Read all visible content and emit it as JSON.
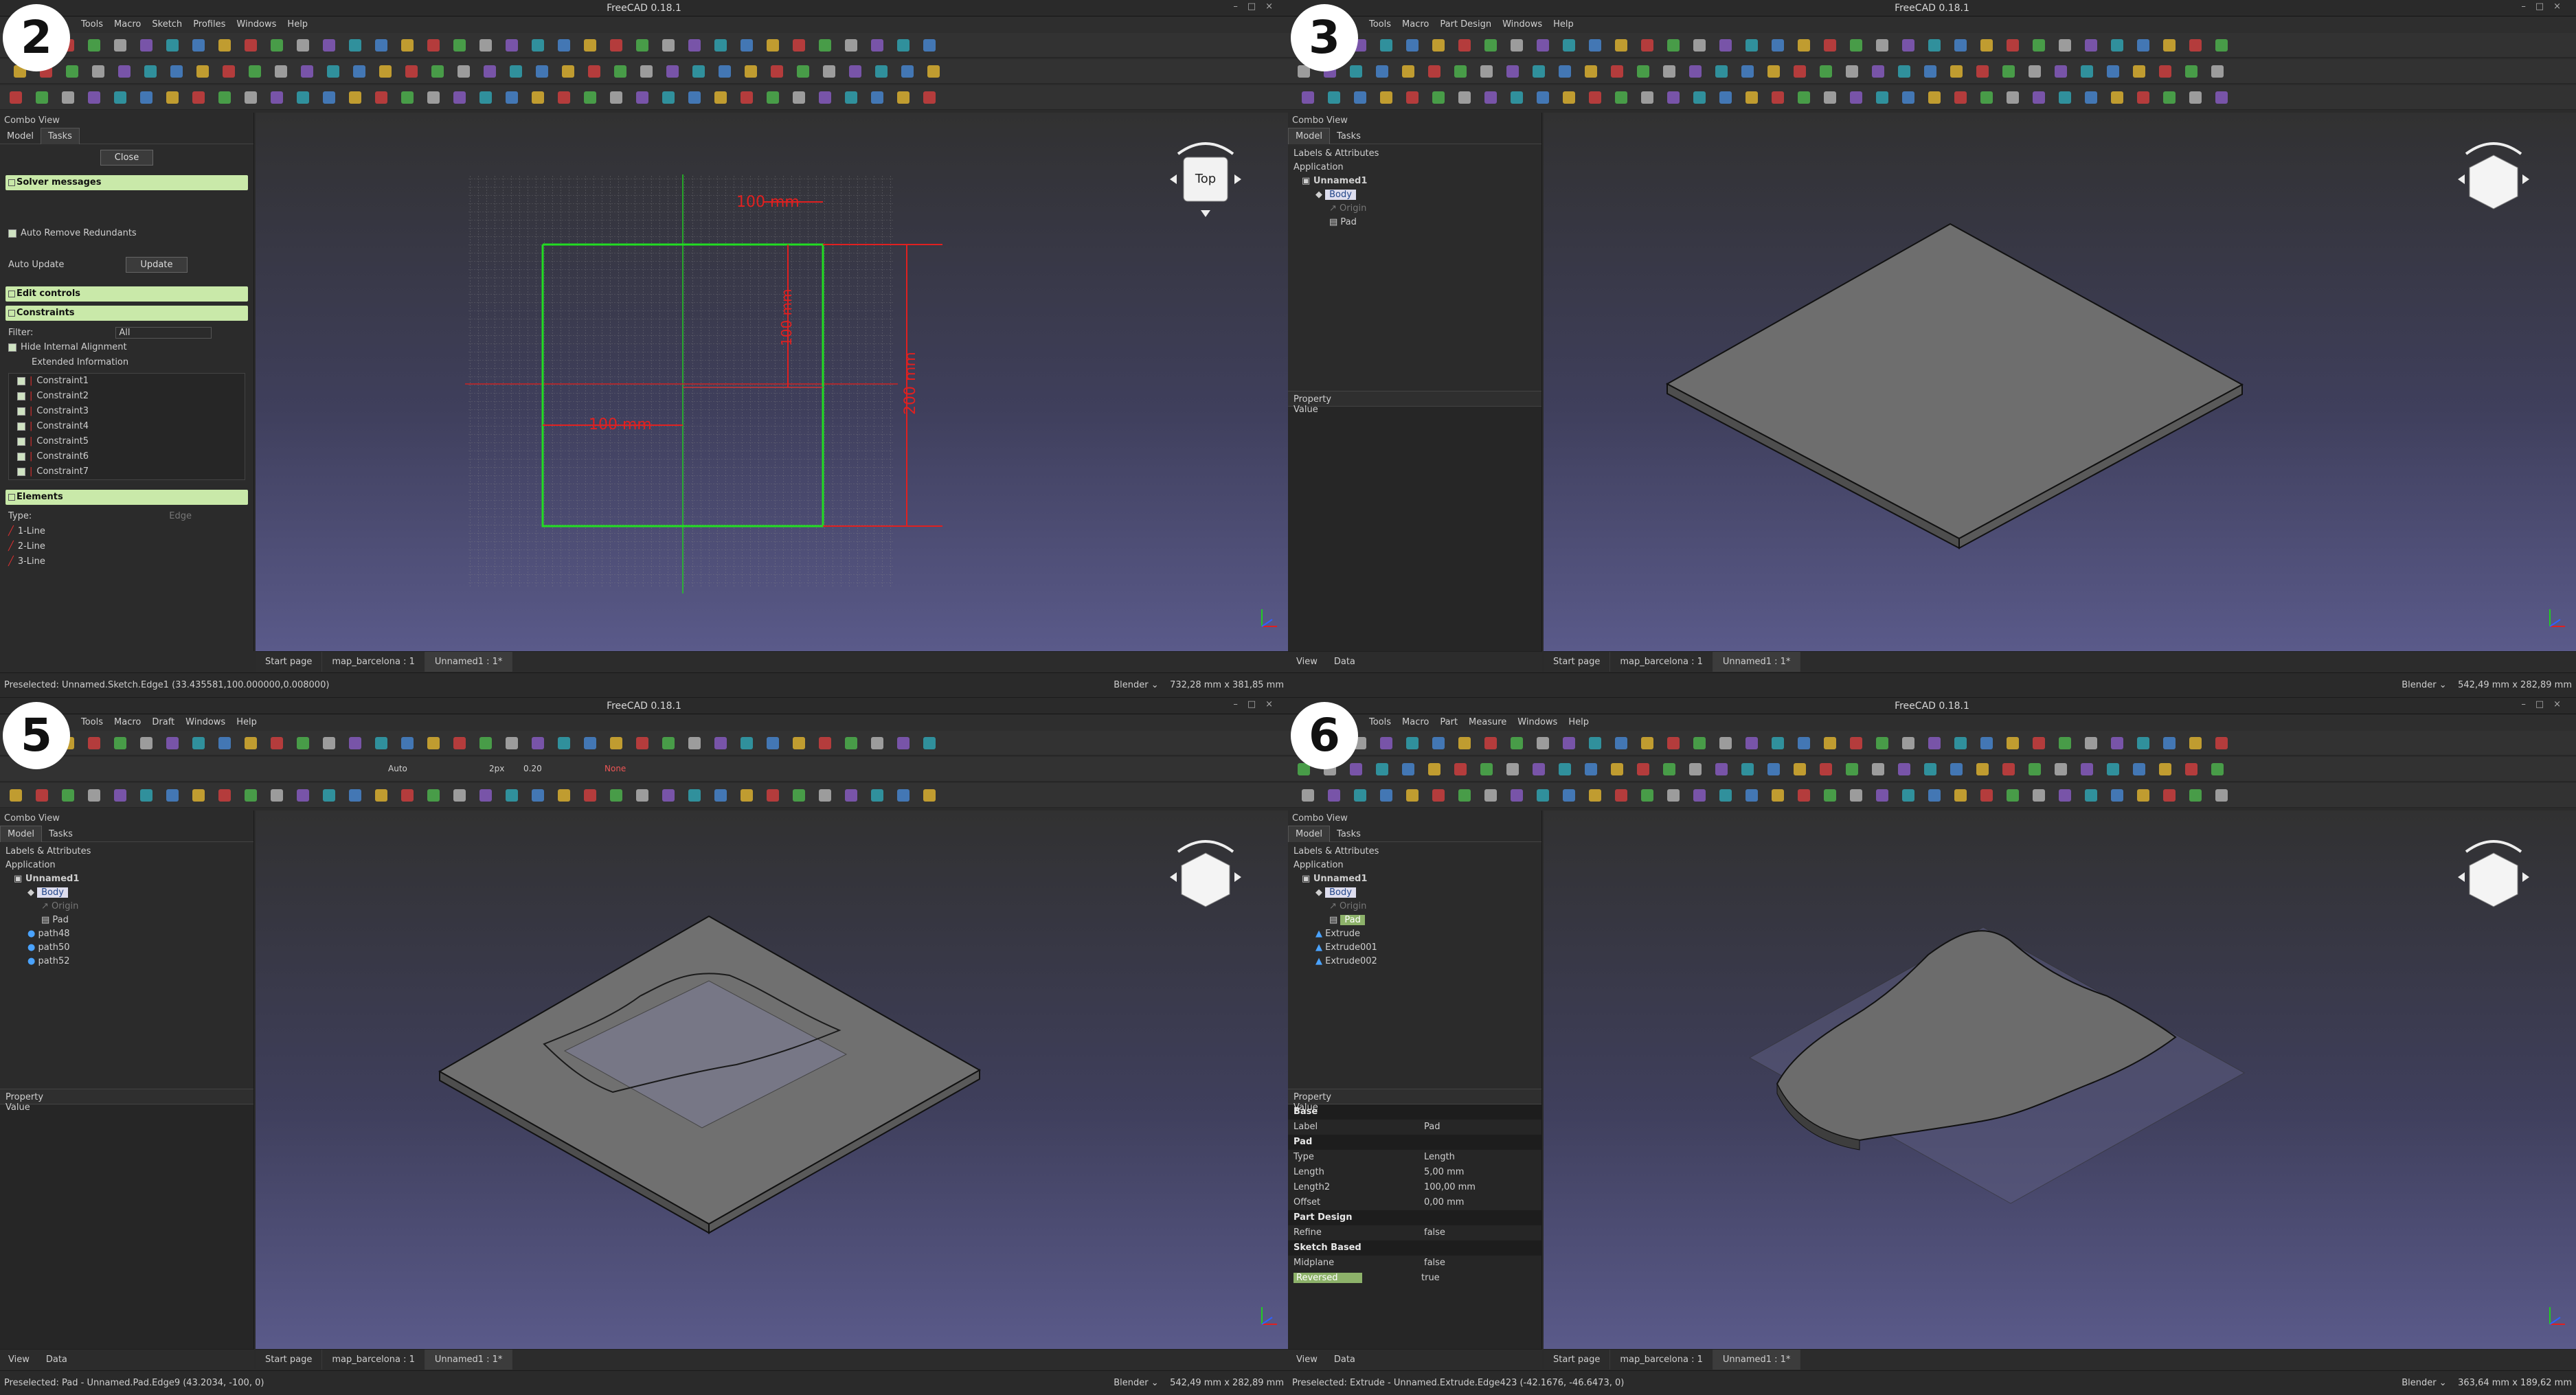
{
  "app_title": "FreeCAD 0.18.1",
  "panels": [
    {
      "badge": "2",
      "menu": [
        "File",
        "Edit",
        "View",
        "Tools",
        "Macro",
        "Sketch",
        "Profiles",
        "Windows",
        "Help"
      ],
      "combo_title": "Combo View",
      "tabs": [
        "Model",
        "Tasks"
      ],
      "close_label": "Close",
      "solver_section": "Solver messages",
      "auto_remove": "Auto Remove Redundants",
      "auto_update": "Auto Update",
      "update_label": "Update",
      "edit_controls": "Edit controls",
      "constraints_section": "Constraints",
      "filter_label": "Filter:",
      "filter_value": "All",
      "hide_internal": "Hide Internal Alignment",
      "extended_info": "Extended Information",
      "constraints": [
        "Constraint1",
        "Constraint2",
        "Constraint3",
        "Constraint4",
        "Constraint5",
        "Constraint6",
        "Constraint7"
      ],
      "elements_section": "Elements",
      "type_label": "Type:",
      "type_value": "Edge",
      "elements": [
        "1-Line",
        "2-Line",
        "3-Line"
      ],
      "dims": {
        "d1": "100 mm",
        "d2": "100 mm",
        "d3": "200 mm",
        "d4": "100 mm"
      },
      "doc_tabs": [
        "Start page",
        "map_barcelona : 1",
        "Unnamed1 : 1*"
      ],
      "status_left": "Preselected: Unnamed.Sketch.Edge1 (33.435581,100.000000,0.008000)",
      "status_nav": "Blender",
      "status_dims": "732,28 mm x 381,85 mm",
      "cube_label": "Top"
    },
    {
      "badge": "3",
      "menu": [
        "File",
        "Edit",
        "View",
        "Tools",
        "Macro",
        "Part Design",
        "Windows",
        "Help"
      ],
      "combo_title": "Combo View",
      "tabs": [
        "Model",
        "Tasks"
      ],
      "tree_header": "Labels & Attributes",
      "tree_app": "Application",
      "tree": [
        "Unnamed1",
        "Body",
        "Origin",
        "Pad"
      ],
      "prop_header": "Property",
      "value_header": "Value",
      "bottom_tabs": [
        "View",
        "Data"
      ],
      "doc_tabs": [
        "Start page",
        "map_barcelona : 1",
        "Unnamed1 : 1*"
      ],
      "status_left": "",
      "status_nav": "Blender",
      "status_dims": "542,49 mm x 282,89 mm"
    },
    {
      "badge": "5",
      "menu": [
        "File",
        "Edit",
        "View",
        "Tools",
        "Macro",
        "Draft",
        "Windows",
        "Help"
      ],
      "combo_title": "Combo View",
      "tabs": [
        "Model",
        "Tasks"
      ],
      "tree_header": "Labels & Attributes",
      "tree_app": "Application",
      "tree": [
        "Unnamed1",
        "Body",
        "Origin",
        "Pad",
        "path48",
        "path50",
        "path52"
      ],
      "prop_header": "Property",
      "value_header": "Value",
      "bottom_tabs": [
        "View",
        "Data"
      ],
      "draft_auto": "Auto",
      "draft_px": "2px",
      "draft_val": "0.20",
      "draft_none": "None",
      "doc_tabs": [
        "Start page",
        "map_barcelona : 1",
        "Unnamed1 : 1*"
      ],
      "status_left": "Preselected: Pad - Unnamed.Pad.Edge9 (43.2034, -100, 0)",
      "status_nav": "Blender",
      "status_dims": "542,49 mm x 282,89 mm"
    },
    {
      "badge": "6",
      "menu": [
        "File",
        "Edit",
        "View",
        "Tools",
        "Macro",
        "Part",
        "Measure",
        "Windows",
        "Help"
      ],
      "combo_title": "Combo View",
      "tabs": [
        "Model",
        "Tasks"
      ],
      "tree_header": "Labels & Attributes",
      "tree_app": "Application",
      "tree": [
        "Unnamed1",
        "Body",
        "Origin",
        "Pad",
        "Extrude",
        "Extrude001",
        "Extrude002"
      ],
      "prop_header": "Property",
      "value_header": "Value",
      "props": [
        {
          "k": "Base",
          "v": "",
          "group": true
        },
        {
          "k": "Label",
          "v": "Pad"
        },
        {
          "k": "Pad",
          "v": "",
          "group": true
        },
        {
          "k": "Type",
          "v": "Length"
        },
        {
          "k": "Length",
          "v": "5,00 mm"
        },
        {
          "k": "Length2",
          "v": "100,00 mm"
        },
        {
          "k": "Offset",
          "v": "0,00 mm"
        },
        {
          "k": "Part Design",
          "v": "",
          "group": true
        },
        {
          "k": "Refine",
          "v": "false"
        },
        {
          "k": "Sketch Based",
          "v": "",
          "group": true
        },
        {
          "k": "Midplane",
          "v": "false"
        },
        {
          "k": "Reversed",
          "v": "true"
        }
      ],
      "bottom_tabs": [
        "View",
        "Data"
      ],
      "doc_tabs": [
        "Start page",
        "map_barcelona : 1",
        "Unnamed1 : 1*"
      ],
      "status_left": "Preselected: Extrude - Unnamed.Extrude.Edge423 (-42.1676, -46.6473, 0)",
      "status_nav": "Blender",
      "status_dims": "363,64 mm x 189,62 mm"
    }
  ],
  "colors": {
    "accent_green": "#c9e9a9",
    "sketch_red": "#e02020",
    "sketch_green": "#22cc22",
    "viewport_top": "#313131",
    "viewport_bottom": "#5a5a8a"
  }
}
